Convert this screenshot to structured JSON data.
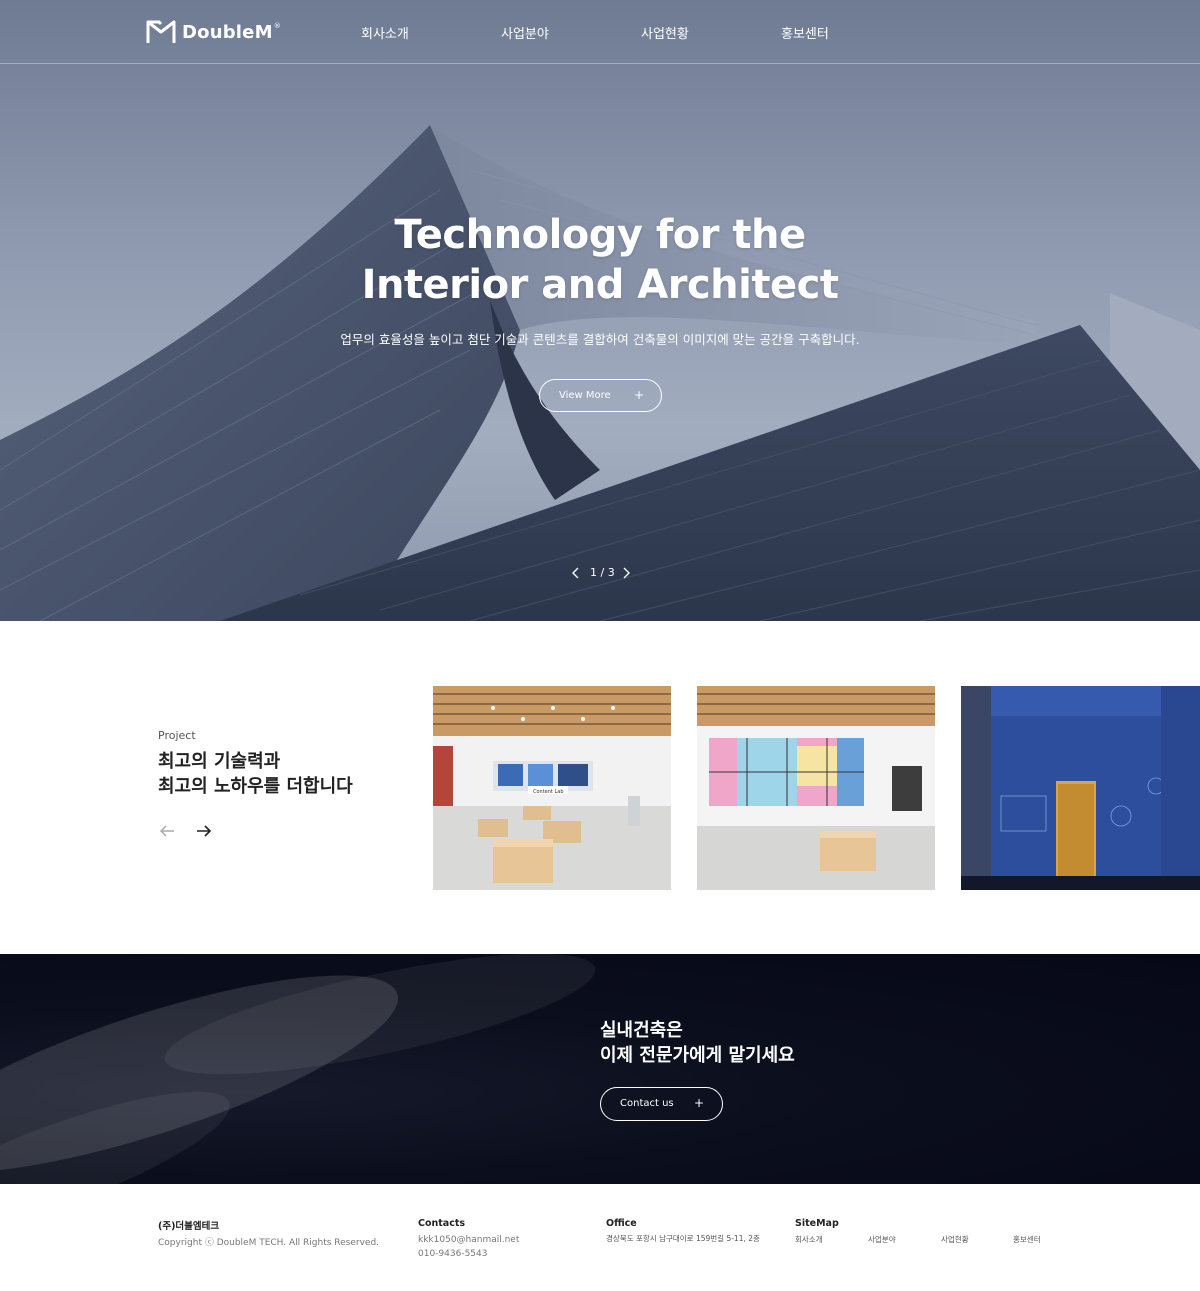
{
  "brand": {
    "name": "DoubleM",
    "reg": "®"
  },
  "nav": {
    "items": [
      "회사소개",
      "사업분야",
      "사업현황",
      "홍보센터"
    ]
  },
  "hero": {
    "title_line1": "Technology for the",
    "title_line2": "Interior and Architect",
    "description": "업무의 효율성을 높이고 첨단 기술과 콘텐츠를 결합하여 건축물의 이미지에 맞는 공간을 구축합니다.",
    "button_label": "View More",
    "button_plus": "+",
    "pager": "1 / 3"
  },
  "project": {
    "label": "Project",
    "title": "최고의 기술력과\n최고의 노하우를 더합니다",
    "card1_sign": "Content Lab"
  },
  "cta": {
    "title": "실내건축은\n이제 전문가에게 맡기세요",
    "button_label": "Contact us",
    "button_plus": "+"
  },
  "footer": {
    "company": {
      "name": "(주)더블엠테크",
      "copyright": "Copyright ⓒ DoubleM TECH. All Rights Reserved."
    },
    "contacts": {
      "heading": "Contacts",
      "email": "kkk1050@hanmail.net",
      "phone": "010-9436-5543"
    },
    "office": {
      "heading": "Office",
      "address": "경상북도 포항시 남구대이로 159번길 5-11, 2층"
    },
    "sitemap": {
      "heading": "SiteMap",
      "links": [
        "회사소개",
        "사업분야",
        "사업현황",
        "홍보센터"
      ]
    }
  },
  "colors": {
    "hero_sky": "#8f9ab0",
    "building": "#3a455c",
    "cta_bg": "#060818",
    "white": "#ffffff"
  }
}
